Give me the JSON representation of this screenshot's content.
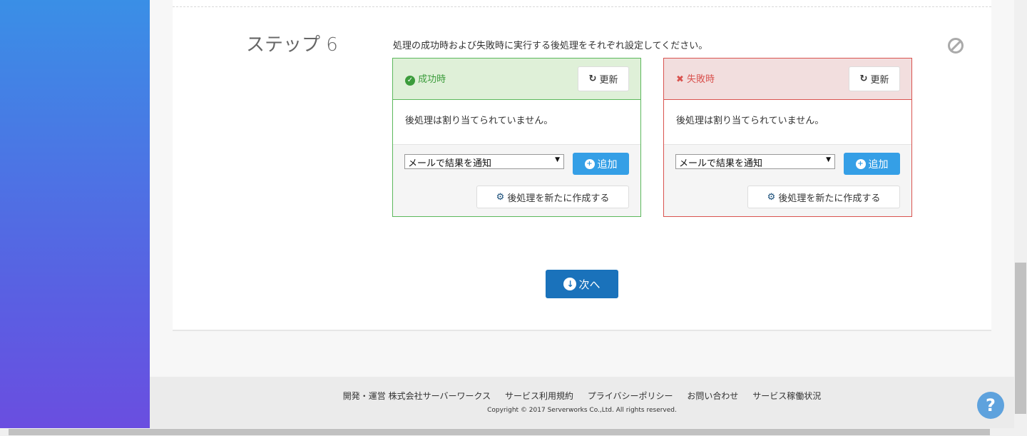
{
  "step": {
    "title": "ステップ 6",
    "description": "処理の成功時および失敗時に実行する後処理をそれぞれ設定してください。"
  },
  "success": {
    "title": "成功時",
    "refresh": "更新",
    "empty": "後処理は割り当てられていません。",
    "select": "メールで結果を通知",
    "add": "追加",
    "create": "後処理を新たに作成する"
  },
  "failure": {
    "title": "失敗時",
    "refresh": "更新",
    "empty": "後処理は割り当てられていません。",
    "select": "メールで結果を通知",
    "add": "追加",
    "create": "後処理を新たに作成する"
  },
  "next": "次へ",
  "footer": {
    "links": [
      "開発・運営 株式会社サーバーワークス",
      "サービス利用規約",
      "プライバシーポリシー",
      "お問い合わせ",
      "サービス稼働状況"
    ],
    "copyright": "Copyright © 2017 Serverworks Co.,Ltd. All rights reserved."
  },
  "help": "?"
}
